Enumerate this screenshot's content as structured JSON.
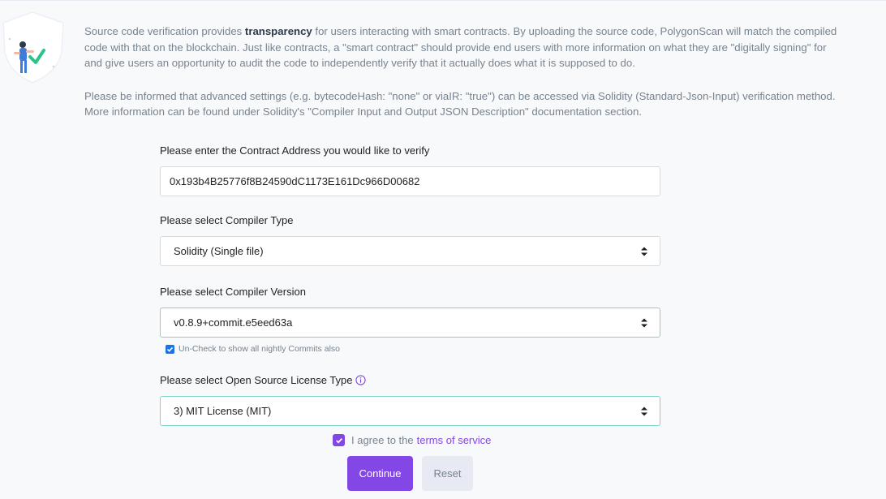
{
  "intro": {
    "p1_before": "Source code verification provides ",
    "p1_bold": "transparency",
    "p1_after": " for users interacting with smart contracts. By uploading the source code, PolygonScan will match the compiled code with that on the blockchain. Just like contracts, a \"smart contract\" should provide end users with more information on what they are \"digitally signing\" for and give users an opportunity to audit the code to independently verify that it actually does what it is supposed to do.",
    "p2": "Please be informed that advanced settings (e.g. bytecodeHash: \"none\" or viaIR: \"true\") can be accessed via Solidity (Standard-Json-Input) verification method. More information can be found under Solidity's \"Compiler Input and Output JSON Description\" documentation section."
  },
  "form": {
    "address_label": "Please enter the Contract Address you would like to verify",
    "address_value": "0x193b4B25776f8B24590dC1173E161Dc966D00682",
    "compiler_type_label": "Please select Compiler Type",
    "compiler_type_value": "Solidity (Single file)",
    "compiler_version_label": "Please select Compiler Version",
    "compiler_version_value": "v0.8.9+commit.e5eed63a",
    "nightly_label": "Un-Check to show all nightly Commits also",
    "nightly_checked": true,
    "license_label": "Please select Open Source License Type",
    "license_value": "3) MIT License (MIT)",
    "agree_text": "I agree to the",
    "terms_link": "terms of service",
    "agree_checked": true,
    "continue_label": "Continue",
    "reset_label": "Reset"
  },
  "colors": {
    "accent": "#8247e5",
    "focus_border": "#7ed6c5",
    "checkbox_blue": "#1a73e8",
    "muted_text": "#77838f"
  },
  "icons": {
    "illustration": "shield-verified-illustration",
    "select": "select-arrows-icon",
    "info": "info-icon",
    "check": "check-icon"
  }
}
